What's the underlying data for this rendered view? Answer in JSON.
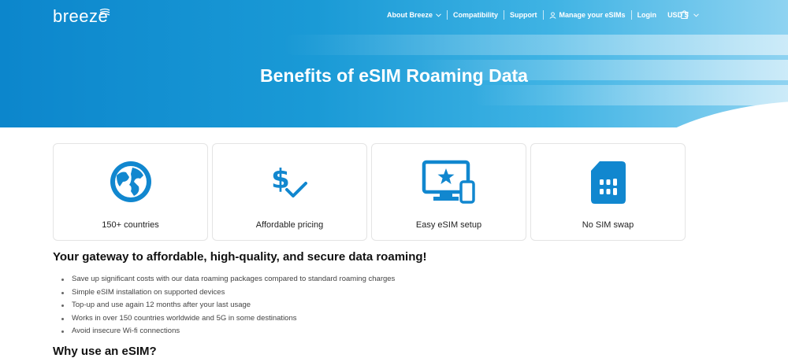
{
  "header": {
    "logo": "breeze",
    "nav": [
      {
        "label": "About Breeze"
      },
      {
        "label": "Compatibility"
      },
      {
        "label": "Support"
      },
      {
        "label": "Manage your eSIMs"
      },
      {
        "label": "Login"
      },
      {
        "label": "USD $"
      }
    ]
  },
  "hero": {
    "title": "Benefits of eSIM Roaming Data"
  },
  "features": [
    {
      "label": "150+ countries",
      "icon": "globe-icon"
    },
    {
      "label": "Affordable pricing",
      "icon": "dollar-check-icon"
    },
    {
      "label": "Easy eSIM setup",
      "icon": "devices-star-icon"
    },
    {
      "label": "No SIM swap",
      "icon": "sim-card-icon"
    }
  ],
  "gateway": {
    "title": "Your gateway to affordable, high-quality, and secure data roaming!",
    "bullets": [
      "Save up significant costs with our data roaming packages compared to standard roaming charges",
      "Simple eSIM  installation on supported devices",
      "Top-up and use again 12 months after your last usage",
      "Works in over 150 countries worldwide and 5G in some destinations",
      "Avoid insecure Wi-fi connections"
    ]
  },
  "why": {
    "title": "Why use an eSIM?"
  },
  "colors": {
    "brand": "#1a9ad6",
    "icon": "#1187cf"
  }
}
